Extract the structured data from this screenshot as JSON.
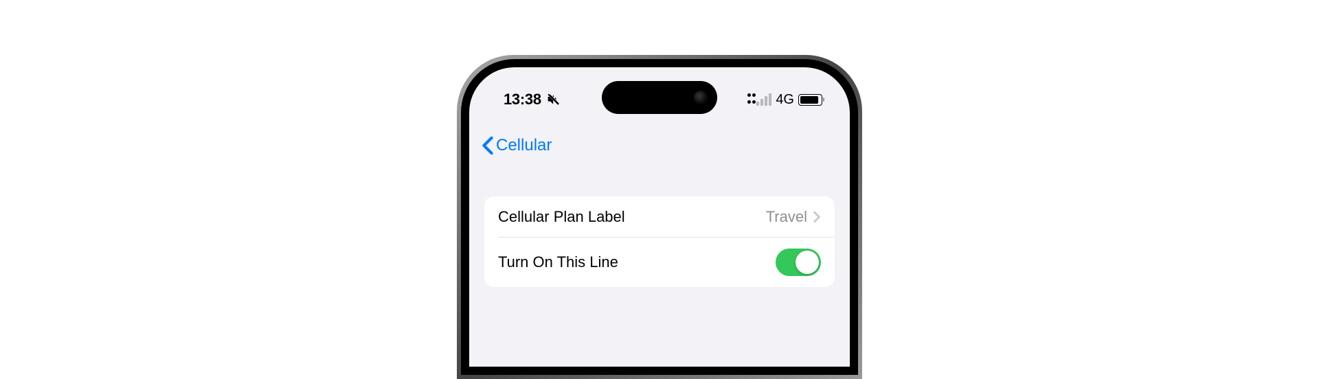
{
  "statusBar": {
    "time": "13:38",
    "networkType": "4G"
  },
  "nav": {
    "backLabel": "Cellular"
  },
  "settings": {
    "planLabel": {
      "title": "Cellular Plan Label",
      "value": "Travel"
    },
    "turnOnLine": {
      "title": "Turn On This Line",
      "enabled": true
    }
  },
  "colors": {
    "accent": "#007aff",
    "toggleOn": "#34c759",
    "secondary": "#8e8e93",
    "background": "#f2f2f7"
  }
}
